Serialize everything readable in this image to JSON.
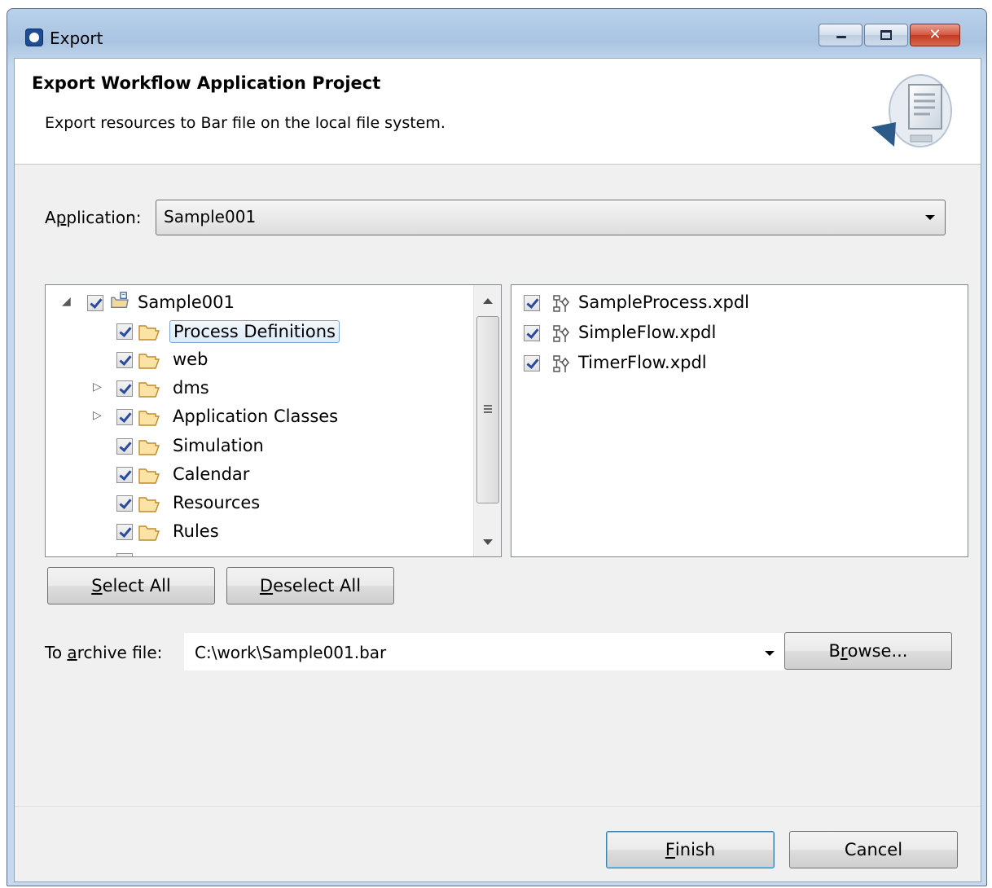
{
  "window": {
    "title": "Export"
  },
  "banner": {
    "title": "Export Workflow Application Project",
    "description": "Export resources to Bar file on the local file system."
  },
  "application": {
    "label_pre": "A",
    "label_mnemonic": "p",
    "label_post": "plication:",
    "selected": "Sample001"
  },
  "tree": {
    "root": {
      "label": "Sample001",
      "checked": true,
      "expanded": true
    },
    "items": [
      {
        "label": "Process Definitions",
        "checked": true,
        "selected": true,
        "expandable": false
      },
      {
        "label": "web",
        "checked": true,
        "expandable": false
      },
      {
        "label": "dms",
        "checked": true,
        "expandable": true
      },
      {
        "label": "Application Classes",
        "checked": true,
        "expandable": true
      },
      {
        "label": "Simulation",
        "checked": true,
        "expandable": false
      },
      {
        "label": "Calendar",
        "checked": true,
        "expandable": false
      },
      {
        "label": "Resources",
        "checked": true,
        "expandable": false
      },
      {
        "label": "Rules",
        "checked": true,
        "expandable": false
      }
    ]
  },
  "files": [
    {
      "label": "SampleProcess.xpdl",
      "checked": true,
      "icon": "workflow-icon"
    },
    {
      "label": "SimpleFlow.xpdl",
      "checked": true,
      "icon": "workflow-icon"
    },
    {
      "label": "TimerFlow.xpdl",
      "checked": true,
      "icon": "workflow-icon"
    }
  ],
  "buttons": {
    "select_all": {
      "mnemonic": "S",
      "rest": "elect All"
    },
    "deselect_all": {
      "mnemonic": "D",
      "rest": "eselect All"
    },
    "browse": {
      "pre": "B",
      "mnemonic": "r",
      "rest": "owse..."
    },
    "finish": {
      "mnemonic": "F",
      "rest": "inish"
    },
    "cancel": "Cancel"
  },
  "archive": {
    "label_pre": "To ",
    "label_mnemonic": "a",
    "label_post": "rchive file:",
    "value": "C:\\work\\Sample001.bar"
  },
  "colors": {
    "selection_border": "#7da2ce",
    "default_button_border": "#3c7fb1",
    "close_button": "#c33a22"
  }
}
